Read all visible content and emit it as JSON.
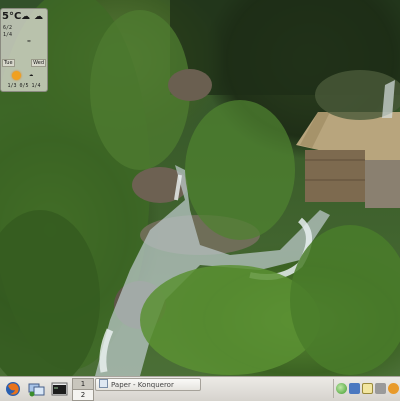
{
  "weather": {
    "temperature": "5°C",
    "row1": "6/2",
    "row2": "1/4",
    "row3": "",
    "forecast_days": [
      "Tue",
      "Wed"
    ],
    "dates": "1/3 0/5 1/4"
  },
  "taskbar": {
    "desktops": [
      "1",
      "2"
    ],
    "task_label": "Paper - Konqueror",
    "launchers": [
      "firefox-icon",
      "network-icon",
      "terminal-icon"
    ],
    "tray_icons": [
      "globe-icon",
      "users-icon",
      "clipboard-icon",
      "speaker-icon",
      "audio-icon"
    ]
  },
  "colors": {
    "taskbar_bg": "#dedbd5",
    "sun": "#f0a020"
  }
}
